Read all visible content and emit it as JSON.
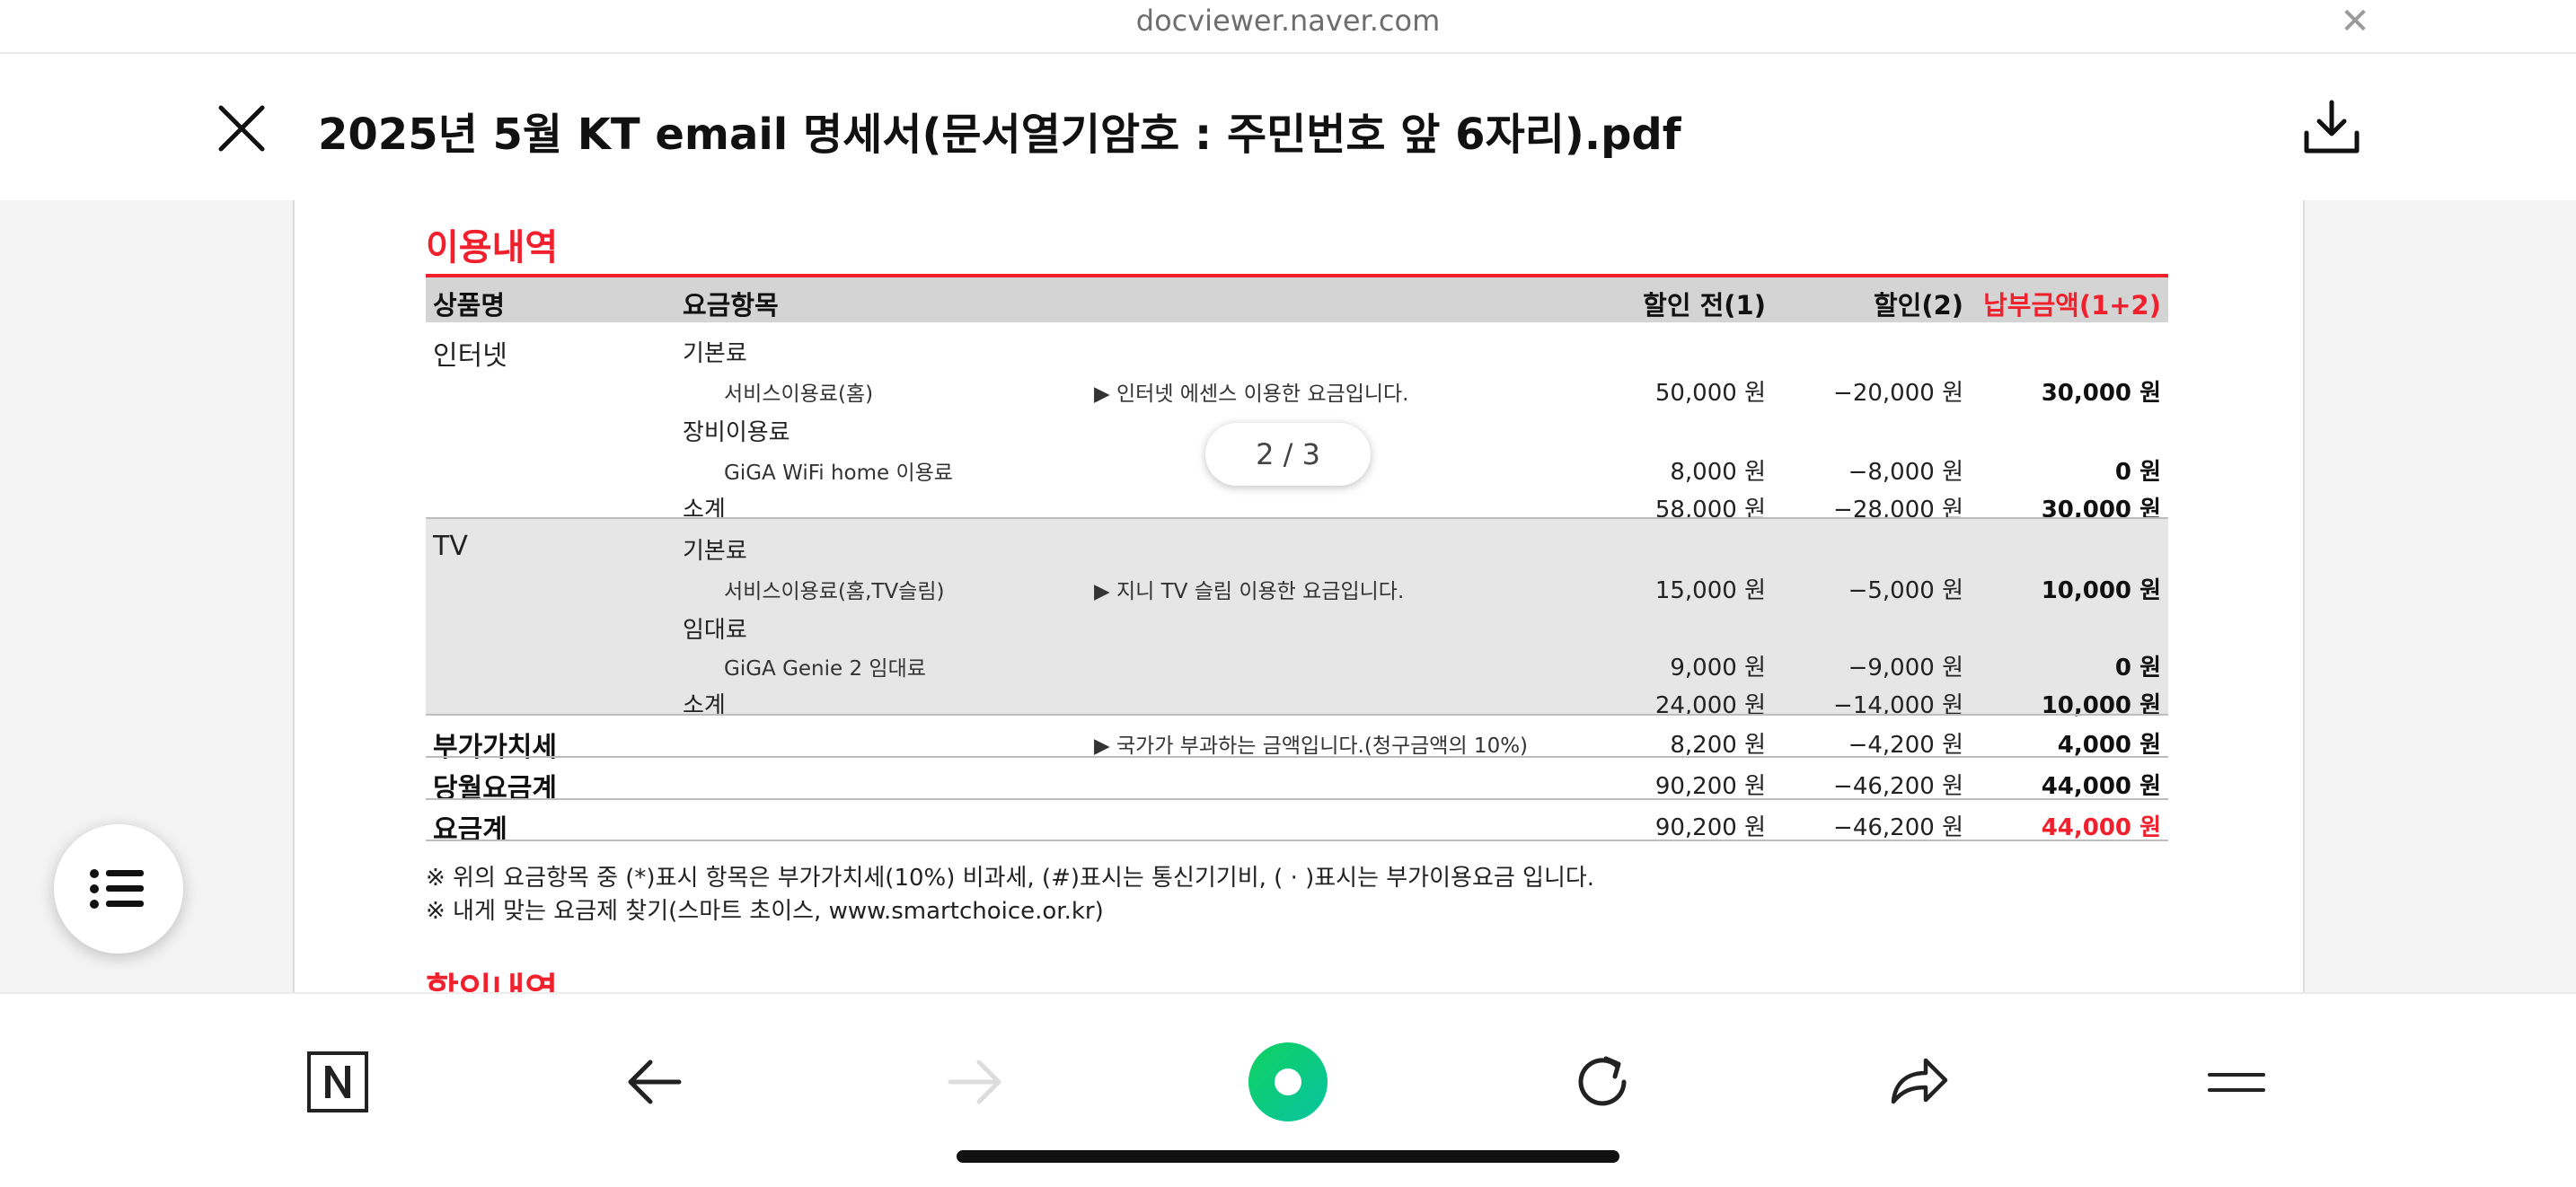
{
  "browser": {
    "url": "docviewer.naver.com",
    "close_icon": "close-icon"
  },
  "header": {
    "title": "2025년 5월 KT email 명세서(문서열기암호 : 주민번호 앞 6자리).pdf",
    "close_icon": "close-icon",
    "download_icon": "download-icon"
  },
  "document": {
    "pager": "2 / 3",
    "section_title": "이용내역",
    "next_section_title": "할인내역",
    "columns": {
      "product": "상품명",
      "item": "요금항목",
      "before": "할인 전(1)",
      "discount": "할인(2)",
      "pay": "납부금액(1+2)"
    },
    "rows": {
      "internet": {
        "name": "인터넷",
        "basic": "기본료",
        "service": "서비스이용료(홈)",
        "service_desc": "▶ 인터넷 에센스 이용한 요금입니다.",
        "service_before": "50,000 원",
        "service_discount": "−20,000 원",
        "service_pay": "30,000 원",
        "equip": "장비이용료",
        "wifi": "GiGA WiFi home 이용료",
        "wifi_before": "8,000 원",
        "wifi_discount": "−8,000 원",
        "wifi_pay": "0 원",
        "subtotal": "소계",
        "sub_before": "58,000 원",
        "sub_discount": "−28,000 원",
        "sub_pay": "30,000 원"
      },
      "tv": {
        "name": "TV",
        "basic": "기본료",
        "service": "서비스이용료(홈,TV슬림)",
        "service_desc": "▶ 지니 TV 슬림 이용한 요금입니다.",
        "service_before": "15,000 원",
        "service_discount": "−5,000 원",
        "service_pay": "10,000 원",
        "rent": "임대료",
        "genie": "GiGA Genie 2 임대료",
        "genie_before": "9,000 원",
        "genie_discount": "−9,000 원",
        "genie_pay": "0 원",
        "subtotal": "소계",
        "sub_before": "24,000 원",
        "sub_discount": "−14,000 원",
        "sub_pay": "10,000 원"
      },
      "vat": {
        "name": "부가가치세",
        "desc": "▶ 국가가 부과하는 금액입니다.(청구금액의 10%)",
        "before": "8,200 원",
        "discount": "−4,200 원",
        "pay": "4,000 원"
      },
      "monthly": {
        "name": "당월요금계",
        "before": "90,200 원",
        "discount": "−46,200 원",
        "pay": "44,000 원"
      },
      "total": {
        "name": "요금계",
        "before": "90,200 원",
        "discount": "−46,200 원",
        "pay": "44,000 원"
      }
    },
    "notes": [
      "※ 위의 요금항목 중 (*)표시 항목은 부가가치세(10%) 비과세, (#)표시는 통신기기비, ( · )표시는 부가이용요금 입니다.",
      "※ 내게 맞는 요금제 찾기(스마트 초이스, www.smartchoice.or.kr)"
    ]
  },
  "colors": {
    "accent_red": "#f0202d",
    "header_gray": "#d4d4d4",
    "tv_group_gray": "#e6e6e7",
    "green": "#0fd160"
  },
  "toolbar": {
    "toc_icon": "list-icon",
    "naver_icon": "naver-n-icon",
    "back_icon": "arrow-left-icon",
    "forward_icon": "arrow-right-icon",
    "green_icon": "green-dot-icon",
    "reload_icon": "reload-icon",
    "share_icon": "share-icon",
    "menu_icon": "menu-icon"
  }
}
